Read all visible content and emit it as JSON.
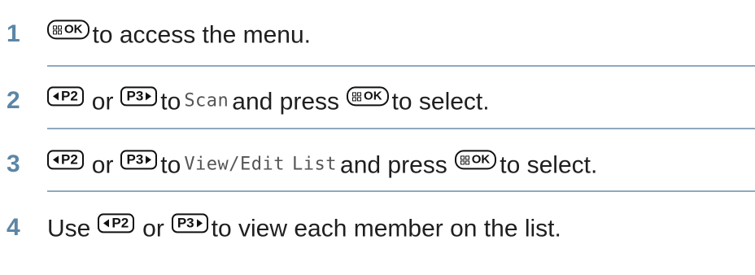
{
  "steps": [
    {
      "number": "1",
      "segments": [
        "to access the menu."
      ],
      "menu_key_label": "OK"
    },
    {
      "number": "2",
      "left_key_label": "P2",
      "right_key_label": "P3",
      "or_text": "or",
      "to_text": "to",
      "lcd_text": "Scan",
      "press_text": "and press",
      "menu_key_label": "OK",
      "tail_text": "to select."
    },
    {
      "number": "3",
      "left_key_label": "P2",
      "right_key_label": "P3",
      "or_text": "or",
      "to_text": "to",
      "lcd_text_1": "View/Edit",
      "lcd_text_2": "List",
      "press_text": "and press",
      "menu_key_label": "OK",
      "tail_text": "to select."
    },
    {
      "number": "4",
      "use_text": "Use",
      "left_key_label": "P2",
      "or_text": "or",
      "right_key_label": "P3",
      "tail_text": "to view each member on the list."
    }
  ],
  "colors": {
    "step_number": "#5c86a6",
    "divider": "#8fa9bf",
    "text": "#1f1f1f"
  },
  "icons": {
    "menu_ok": "menu-ok-button-icon",
    "left": "left-arrow-p2-button-icon",
    "right": "right-arrow-p3-button-icon"
  }
}
